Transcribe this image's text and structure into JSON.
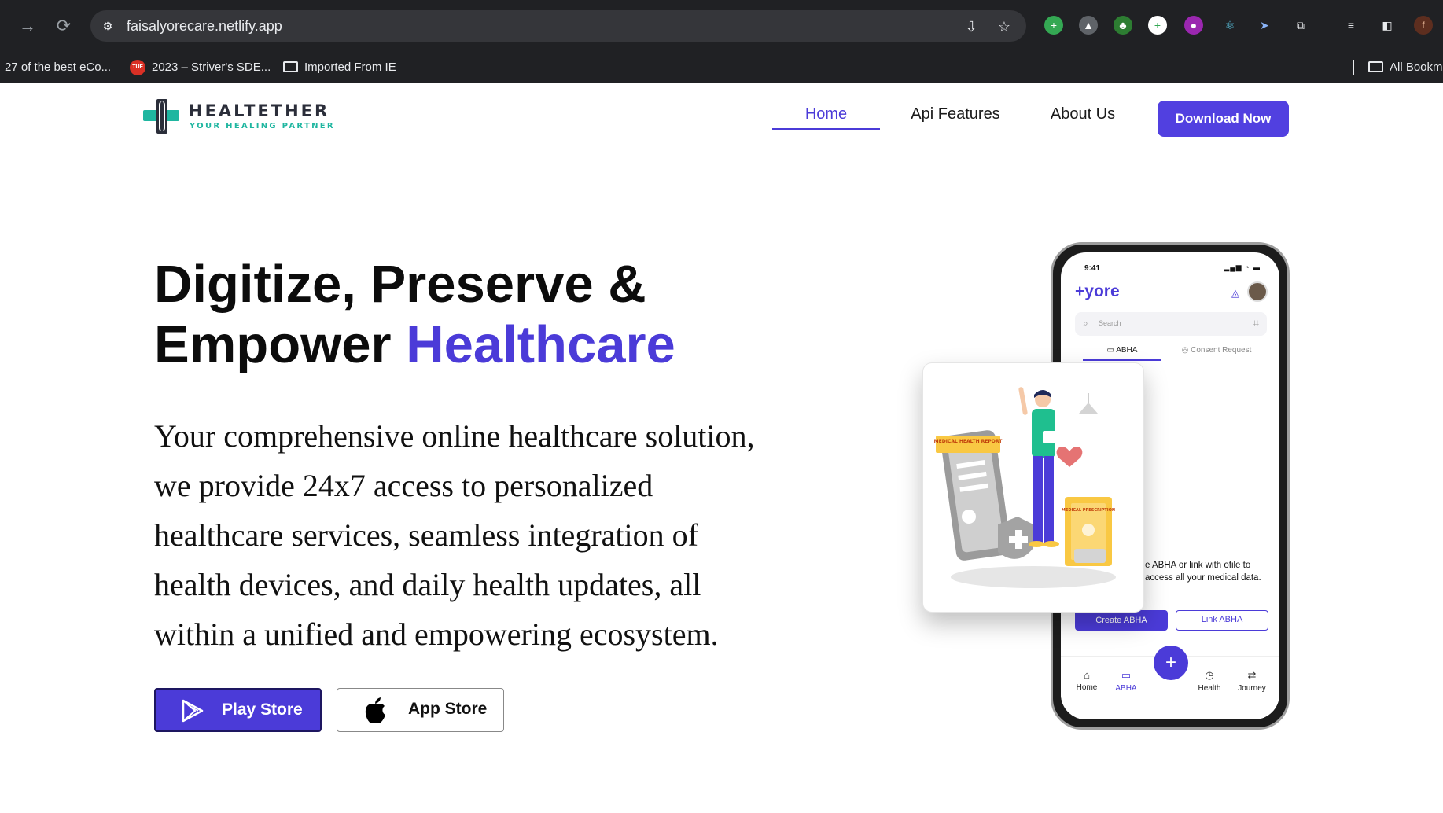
{
  "browser": {
    "url": "faisalyorecare.netlify.app",
    "bookmarks": [
      {
        "label": "27 of the best eCo..."
      },
      {
        "label": "2023 – Striver's SDE...",
        "icon_text": "TUF"
      },
      {
        "label": "Imported From IE"
      }
    ],
    "bookmarks_right": "All Bookm",
    "profile_initial": "f"
  },
  "header": {
    "logo_name": "HEALTETHER",
    "logo_tagline": "YOUR HEALING PARTNER",
    "nav": [
      {
        "label": "Home",
        "active": true
      },
      {
        "label": "Api Features"
      },
      {
        "label": "About Us"
      }
    ],
    "download_label": "Download Now"
  },
  "hero": {
    "title_line1": "Digitize, Preserve &",
    "title_line2_prefix": "Empower ",
    "title_accent": "Healthcare",
    "description_lines": [
      "Your comprehensive online healthcare solution,",
      "we provide 24x7 access to personalized",
      "healthcare services, seamless integration of",
      "health devices, and daily health updates, all",
      "within a unified and empowering ecosystem."
    ],
    "play_store_label": "Play Store",
    "app_store_label": "App Store"
  },
  "phone": {
    "time": "9:41",
    "app_logo": "+yore",
    "search_placeholder": "Search",
    "tab_abha": "ABHA",
    "tab_consent": "Consent Request",
    "info_text": "e ABHA or link with ofile to access all your medical data.",
    "create_label": "Create ABHA",
    "link_label": "Link ABHA",
    "bottom_nav": [
      "Home",
      "ABHA",
      "Health",
      "Journey"
    ]
  },
  "illustration": {
    "card1_text": "MEDICAL HEALTH REPORT",
    "card2_text": "MEDICAL PRESCRIPTION"
  },
  "colors": {
    "accent": "#4b3bd8",
    "button": "#5140e0",
    "logo_teal": "#1fb6a0",
    "logo_dark": "#2b2e3a",
    "browser_bg": "#202124"
  }
}
